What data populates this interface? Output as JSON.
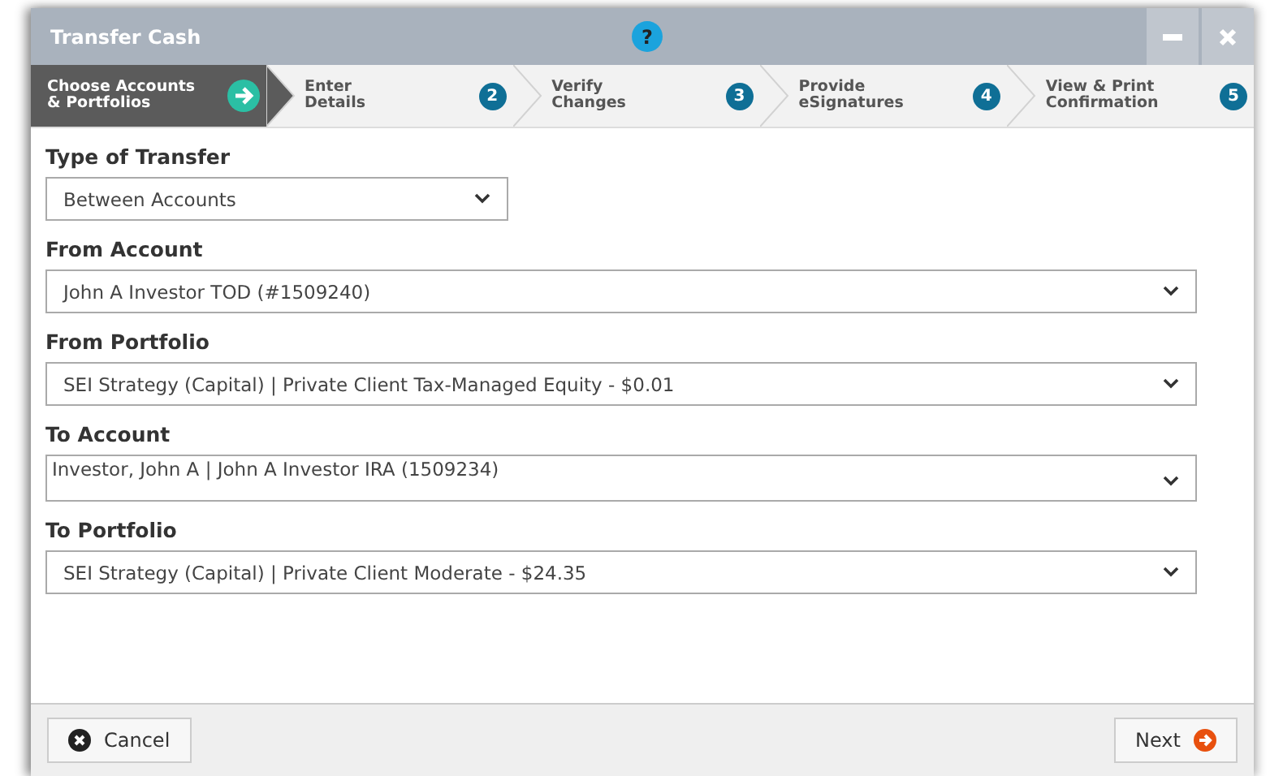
{
  "window": {
    "title": "Transfer Cash",
    "help": "?"
  },
  "steps": [
    {
      "label": "Choose Accounts\n& Portfolios",
      "selected": true
    },
    {
      "label": "Enter\nDetails",
      "number": "2",
      "selected": false
    },
    {
      "label": "Verify\nChanges",
      "number": "3",
      "selected": false
    },
    {
      "label": "Provide\neSignatures",
      "number": "4",
      "selected": false
    },
    {
      "label": "View & Print\nConfirmation",
      "number": "5",
      "selected": false
    }
  ],
  "fields": [
    {
      "label": "Type of Transfer",
      "value": "Between Accounts",
      "kind": "short"
    },
    {
      "label": "From Account",
      "value": "John A Investor TOD (#1509240)",
      "kind": "wide"
    },
    {
      "label": "From Portfolio",
      "value": "SEI Strategy (Capital)  |  Private Client Tax-Managed Equity - $0.01",
      "kind": "wide"
    },
    {
      "label": "To Account",
      "value": "Investor, John A | John A Investor IRA (1509234)",
      "kind": "tall"
    },
    {
      "label": "To Portfolio",
      "value": "SEI Strategy (Capital)  |  Private Client Moderate - $24.35",
      "kind": "wide"
    }
  ],
  "buttons": {
    "cancel": "Cancel",
    "next": "Next"
  }
}
